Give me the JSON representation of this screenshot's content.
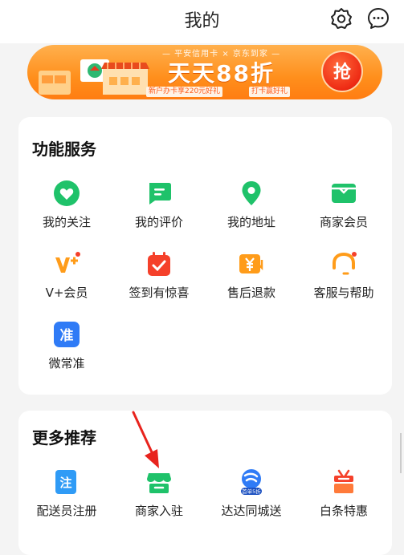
{
  "header": {
    "title": "我的"
  },
  "banner": {
    "top_text": "— 平安信用卡 × 京东到家 —",
    "main_text": "天天88折",
    "tag_1": "新户办卡享220元好礼",
    "tag_2": "打卡赢好礼",
    "button_label": "抢"
  },
  "services": {
    "title": "功能服务",
    "items": [
      {
        "label": "我的关注",
        "icon": "heart-icon"
      },
      {
        "label": "我的评价",
        "icon": "comment-icon"
      },
      {
        "label": "我的地址",
        "icon": "location-pin-icon"
      },
      {
        "label": "商家会员",
        "icon": "member-card-icon"
      },
      {
        "label": "V+会员",
        "icon": "vplus-icon"
      },
      {
        "label": "签到有惊喜",
        "icon": "calendar-checkin-icon"
      },
      {
        "label": "售后退款",
        "icon": "refund-icon"
      },
      {
        "label": "客服与帮助",
        "icon": "headset-icon"
      },
      {
        "label": "微常准",
        "icon": "weichangzhun-icon"
      }
    ]
  },
  "more": {
    "title": "更多推荐",
    "items": [
      {
        "label": "配送员注册",
        "icon": "courier-register-icon"
      },
      {
        "label": "商家入驻",
        "icon": "merchant-join-icon"
      },
      {
        "label": "达达同城送",
        "icon": "dada-delivery-icon",
        "badge": "首单5折"
      },
      {
        "label": "白条特惠",
        "icon": "baitiao-gift-icon"
      }
    ]
  },
  "colors": {
    "green": "#1fc26a",
    "orange": "#ff9c1a",
    "red": "#f5402a",
    "blue": "#2f7bf6"
  }
}
